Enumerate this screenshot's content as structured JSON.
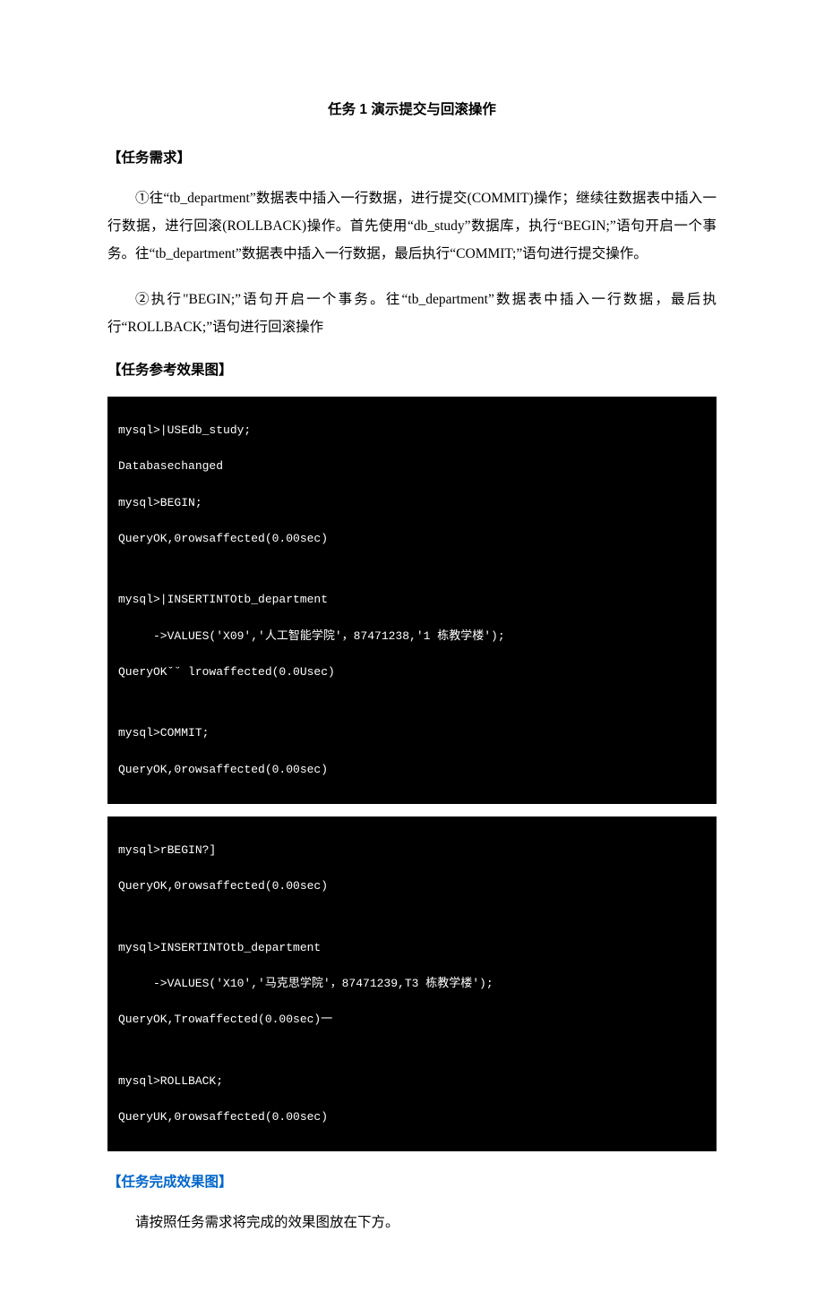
{
  "title": "任务 1 演示提交与回滚操作",
  "heading_requirement": "【任务需求】",
  "para1": "①往“tb_department”数据表中插入一行数据，进行提交(COMMIT)操作；继续往数据表中插入一行数据，进行回滚(ROLLBACK)操作。首先使用“db_study”数据库，执行“BEGIN;”语句开启一个事务。往“tb_department”数据表中插入一行数据，最后执行“COMMIT;”语句进行提交操作。",
  "para2": "②执行\"BEGIN;”语句开启一个事务。往“tb_department”数据表中插入一行数据，最后执行“ROLLBACK;”语句进行回滚操作",
  "heading_reference": "【任务参考效果图】",
  "code1": {
    "l1": "mysql>|USEdb_study;",
    "l2": "Databasechanged",
    "l3": "mysql>BEGIN;",
    "l4": "QueryOK,0rowsaffected(0.00sec)",
    "l5": "mysql>|INSERTINTOtb_department",
    "l6": "->VALUES('X09','人工智能学院'，87471238,'1 栋教学楼');",
    "l7": "QueryOKˇ˘ lrowaffected(0.0Usec)",
    "l8": "mysql>COMMIT;",
    "l9": "QueryOK,0rowsaffected(0.00sec)"
  },
  "code2": {
    "l1": "mysql>rBEGIN?]",
    "l2": "QueryOK,0rowsaffected(0.00sec)",
    "l3": "mysql>INSERTINTOtb_department",
    "l4": "->VALUES('X10','马克思学院'，87471239,T3 栋教学楼');",
    "l5": "QueryOK,Trowaffected(0.00sec)一",
    "l6": "mysql>ROLLBACK;",
    "l7": "QueryUK,0rowsaffected(0.00sec)"
  },
  "heading_complete": "【任务完成效果图】",
  "para3": "请按照任务需求将完成的效果图放在下方。"
}
